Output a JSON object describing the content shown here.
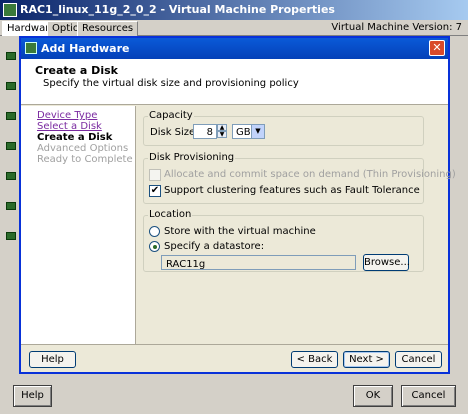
{
  "outer": {
    "title": "RAC1_linux_11g_2_0_2 - Virtual Machine Properties",
    "tabs": [
      "Hardware",
      "Options",
      "Resources"
    ],
    "vm_version": "Virtual Machine Version: 7",
    "help_label": "Help",
    "ok_label": "OK",
    "cancel_label": "Cancel"
  },
  "dialog": {
    "title": "Add Hardware",
    "close_glyph": "✕",
    "header_title": "Create a Disk",
    "header_subtitle": "Specify the virtual disk size and provisioning policy",
    "steps": [
      {
        "label": "Device Type",
        "state": "completed"
      },
      {
        "label": "Select a Disk",
        "state": "completed"
      },
      {
        "label": "Create a Disk",
        "state": "current"
      },
      {
        "label": "Advanced Options",
        "state": "future"
      },
      {
        "label": "Ready to Complete",
        "state": "future"
      }
    ],
    "capacity": {
      "group_label": "Capacity",
      "disk_size_label": "Disk Size:",
      "disk_size_value": "8",
      "unit": "GB"
    },
    "provisioning": {
      "group_label": "Disk Provisioning",
      "thin_label": "Allocate and commit space on demand (Thin Provisioning)",
      "thin_checked": false,
      "thin_enabled": false,
      "ft_label": "Support clustering features such as Fault Tolerance",
      "ft_checked": true
    },
    "location": {
      "group_label": "Location",
      "store_with_vm_label": "Store with the virtual machine",
      "specify_datastore_label": "Specify a datastore:",
      "selected": "specify",
      "datastore_value": "RAC11g",
      "browse_label": "Browse..."
    },
    "footer": {
      "help_label": "Help",
      "back_label": "< Back",
      "next_label": "Next >",
      "cancel_label": "Cancel"
    }
  },
  "colors": {
    "titlebar": "#0a5ad8",
    "link": "#7a2aa0",
    "disabled_text": "#a0a0a0"
  }
}
